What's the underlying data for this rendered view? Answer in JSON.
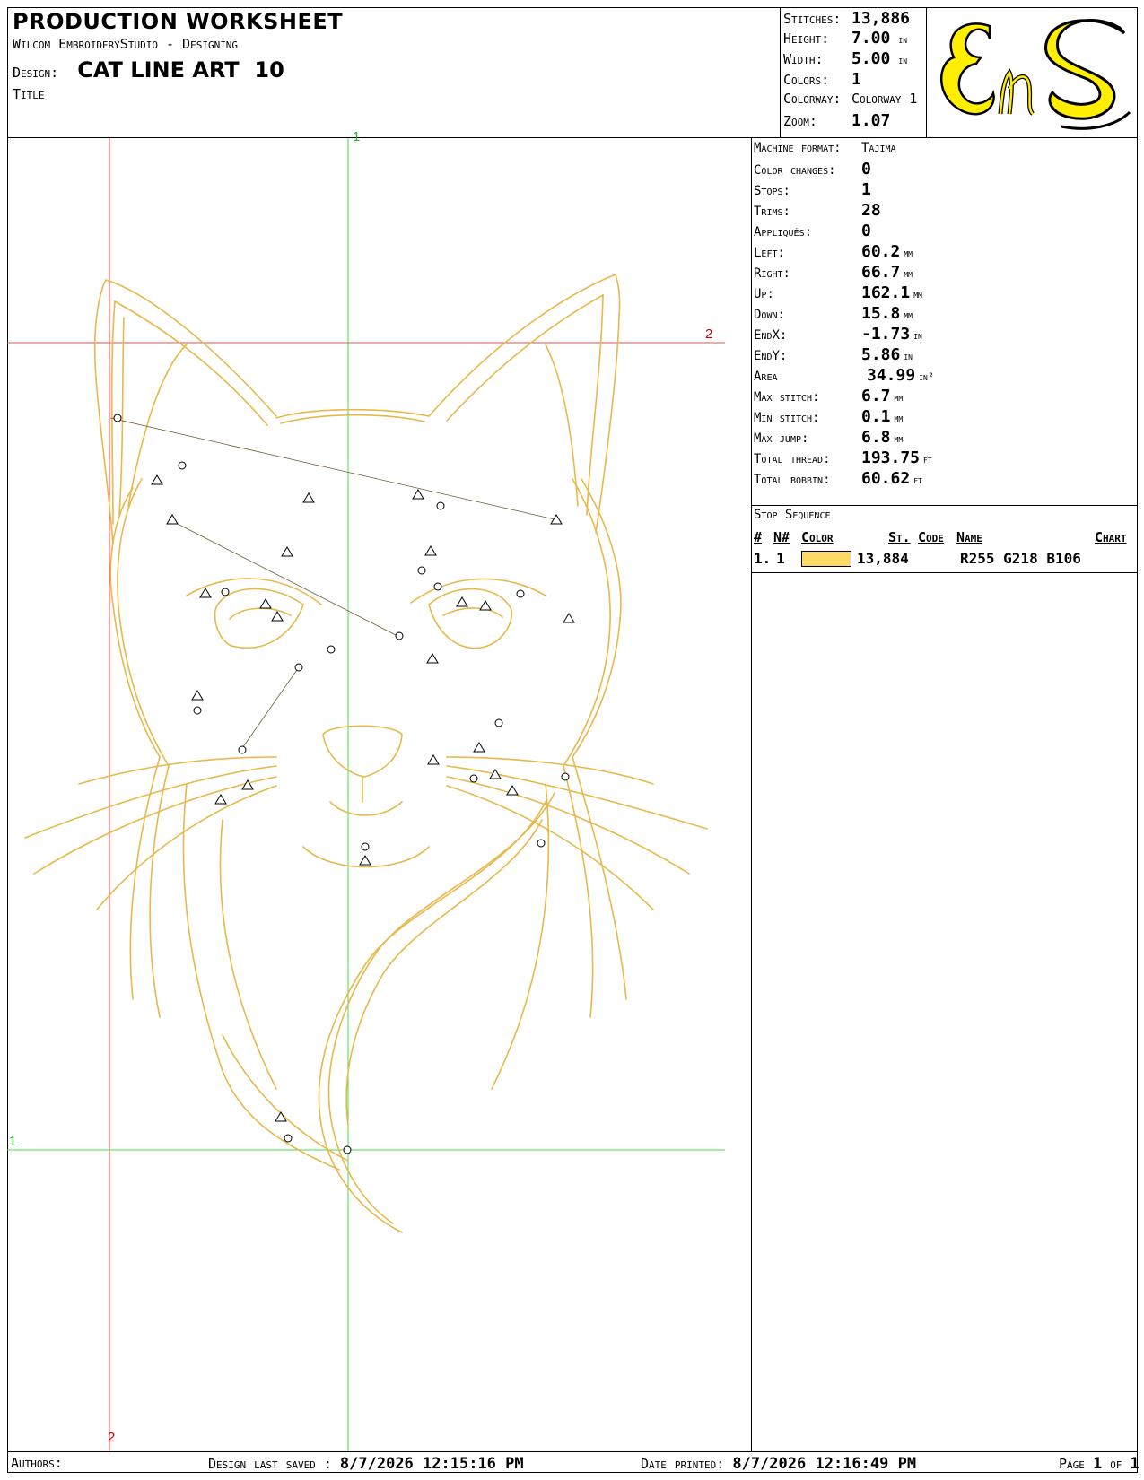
{
  "header": {
    "title": "Production Worksheet",
    "software": "Wilcom EmbroideryStudio - Designing",
    "design_label": "Design:",
    "design_name": "CAT LINE ART  10",
    "title_label": "Title"
  },
  "summary": {
    "stitches_label": "Stitches:",
    "stitches": "13,886",
    "height_label": "Height:",
    "height": "7.00",
    "height_unit": "in",
    "width_label": "Width:",
    "width": "5.00",
    "width_unit": "in",
    "colors_label": "Colors:",
    "colors": "1",
    "colorway_label": "Colorway:",
    "colorway": "Colorway 1",
    "zoom_label": "Zoom:",
    "zoom": "1.07"
  },
  "logo": {
    "text": "EnS",
    "bg": "#ffffff",
    "fill": "#ffee00"
  },
  "properties": {
    "machine_format_label": "Machine format:",
    "machine_format": "Tajima",
    "color_changes_label": "Color changes:",
    "color_changes": "0",
    "stops_label": "Stops:",
    "stops": "1",
    "trims_label": "Trims:",
    "trims": "28",
    "appliques_label": "Appliqués:",
    "appliques": "0",
    "left_label": "Left:",
    "left": "60.2",
    "left_unit": "mm",
    "right_label": "Right:",
    "right": "66.7",
    "right_unit": "mm",
    "up_label": "Up:",
    "up": "162.1",
    "up_unit": "mm",
    "down_label": "Down:",
    "down": "15.8",
    "down_unit": "mm",
    "endx_label": "EndX:",
    "endx": "-1.73",
    "endx_unit": "in",
    "endy_label": "EndY:",
    "endy": "5.86",
    "endy_unit": "in",
    "area_label": "Area",
    "area": "34.99",
    "area_unit": "in²",
    "max_stitch_label": "Max stitch:",
    "max_stitch": "6.7",
    "max_stitch_unit": "mm",
    "min_stitch_label": "Min stitch:",
    "min_stitch": "0.1",
    "min_stitch_unit": "mm",
    "max_jump_label": "Max jump:",
    "max_jump": "6.8",
    "max_jump_unit": "mm",
    "total_thread_label": "Total thread:",
    "total_thread": "193.75",
    "total_thread_unit": "ft",
    "total_bobbin_label": "Total bobbin:",
    "total_bobbin": "60.62",
    "total_bobbin_unit": "ft"
  },
  "stop_sequence": {
    "title": "Stop Sequence",
    "headers": {
      "num": "#",
      "n_num": "N#",
      "color": "Color",
      "st": "St.",
      "code": "Code",
      "name": "Name",
      "chart": "Chart"
    },
    "rows": [
      {
        "num": "1.",
        "n_num": "1",
        "color": "#ffd966",
        "st": "13,884",
        "code": "",
        "name": "R255 G218 B106",
        "chart": ""
      }
    ]
  },
  "canvas": {
    "guide_1_top": "1",
    "guide_2_right": "2",
    "guide_1_left": "1",
    "guide_2_bottom": "2",
    "thread_color": "#e8b84a"
  },
  "footer": {
    "authors_label": "Authors:",
    "saved_label": "Design last saved :",
    "saved": "8/7/2026 12:15:16 PM",
    "printed_label": "Date printed:",
    "printed": "8/7/2026 12:16:49 PM",
    "page_label": "Page",
    "page": "1",
    "of": "of",
    "total": "1"
  }
}
